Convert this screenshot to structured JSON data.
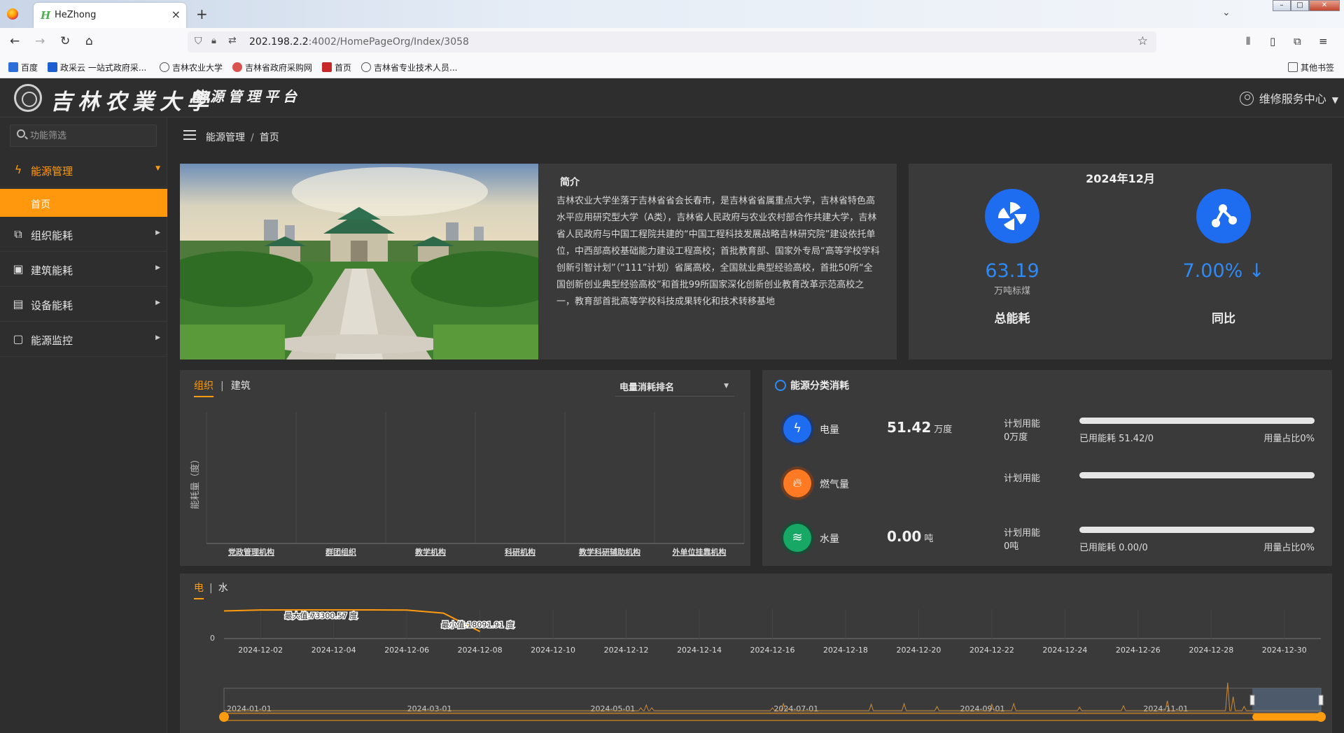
{
  "browser": {
    "tab_title": "HeZhong",
    "tab_favicon": "H",
    "url_host": "202.198.2.2",
    "url_path": ":4002/HomePageOrg/Index/3058",
    "bookmarks": [
      "百度",
      "政采云 一站式政府采...",
      "吉林农业大学",
      "吉林省政府采购网",
      "首页",
      "吉林省专业技术人员..."
    ],
    "other_bookmarks": "其他书签",
    "icons": [
      "back-icon",
      "forward-icon",
      "reload-icon",
      "home-icon",
      "shield-icon",
      "lock-icon",
      "star-icon",
      "library-icon",
      "sidebar-icon",
      "extensions-icon",
      "menu-icon"
    ]
  },
  "header": {
    "school_name": "吉林农業大學",
    "platform_name": "能源管理平台",
    "service_center": "维修服务中心"
  },
  "sidebar": {
    "search_placeholder": "功能筛选",
    "items": [
      {
        "label": "能源管理",
        "icon": "energy-icon",
        "active": true
      },
      {
        "label": "组织能耗",
        "icon": "org-icon"
      },
      {
        "label": "建筑能耗",
        "icon": "building-icon"
      },
      {
        "label": "设备能耗",
        "icon": "device-icon"
      },
      {
        "label": "能源监控",
        "icon": "monitor-icon"
      }
    ],
    "home_label": "首页"
  },
  "breadcrumb": {
    "parent": "能源管理",
    "sep": "/",
    "current": "首页"
  },
  "intro": {
    "title": "简介",
    "text": "吉林农业大学坐落于吉林省省会长春市，是吉林省省属重点大学，吉林省特色高水平应用研究型大学（A类），吉林省人民政府与农业农村部合作共建大学，吉林省人民政府与中国工程院共建的“中国工程科技发展战略吉林研究院”建设依托单位，中西部高校基础能力建设工程高校；首批教育部、国家外专局“高等学校学科创新引智计划”（“111”计划）省属高校，全国就业典型经验高校，首批50所“全国创新创业典型经验高校”和首批99所国家深化创新创业教育改革示范高校之一，教育部首批高等学校科技成果转化和技术转移基地"
  },
  "summary": {
    "date": "2024年12月",
    "total": {
      "value": "63.19",
      "unit": "万吨标煤",
      "name": "总能耗"
    },
    "yoy": {
      "value": "7.00% ↓",
      "unit": "",
      "name": "同比"
    }
  },
  "ranking": {
    "tab_org": "组织",
    "tab_building": "建筑",
    "select": "电量消耗排名",
    "chart_data": {
      "type": "bar",
      "ylabel": "能耗量（度）",
      "categories": [
        "党政管理机构",
        "群团组织",
        "教学机构",
        "科研机构",
        "教学科研辅助机构",
        "外单位挂靠机构"
      ],
      "values": [
        0,
        0,
        0,
        0,
        0,
        0
      ]
    }
  },
  "categories": {
    "title": "能源分类消耗",
    "rows": [
      {
        "name": "电量",
        "value": "51.42",
        "unit": "万度",
        "plan_label": "计划用能",
        "plan_value": "0万度",
        "used": "已用能耗 51.42/0",
        "ratio": "用量占比0%",
        "fill": 0,
        "color": "#1e6cf0",
        "icon": "lightning-icon"
      },
      {
        "name": "燃气量",
        "value": "",
        "unit": "",
        "plan_label": "计划用能",
        "plan_value": "",
        "used": "",
        "ratio": "",
        "fill": 0,
        "color": "#ff7a22",
        "icon": "flame-icon"
      },
      {
        "name": "水量",
        "value": "0.00",
        "unit": "吨",
        "plan_label": "计划用能",
        "plan_value": "0吨",
        "used": "已用能耗 0.00/0",
        "ratio": "用量占比0%",
        "fill": 0,
        "color": "#17a866",
        "icon": "water-icon"
      }
    ]
  },
  "trend": {
    "tab_elec": "电",
    "tab_water": "水",
    "chart_data": {
      "type": "line",
      "y_ticks": [
        "0"
      ],
      "x_ticks": [
        "2024-12-02",
        "2024-12-04",
        "2024-12-06",
        "2024-12-08",
        "2024-12-10",
        "2024-12-12",
        "2024-12-14",
        "2024-12-16",
        "2024-12-18",
        "2024-12-20",
        "2024-12-22",
        "2024-12-24",
        "2024-12-26",
        "2024-12-28",
        "2024-12-30"
      ],
      "max_label": "最大值:73300.57 度",
      "min_label": "最小值:18091.91 度",
      "x": [
        "2024-12-01",
        "2024-12-02",
        "2024-12-03",
        "2024-12-04",
        "2024-12-05",
        "2024-12-06",
        "2024-12-07",
        "2024-12-08"
      ],
      "values": [
        70500,
        73000,
        73200,
        73300.57,
        73200,
        72600,
        65000,
        18091.91
      ],
      "zoom_ticks": [
        "2024-01-01",
        "2024-03-01",
        "2024-05-01",
        "2024-07-01",
        "2024-09-01",
        "2024-11-01"
      ],
      "zoom_window": [
        0.9375,
        1.0
      ]
    }
  }
}
